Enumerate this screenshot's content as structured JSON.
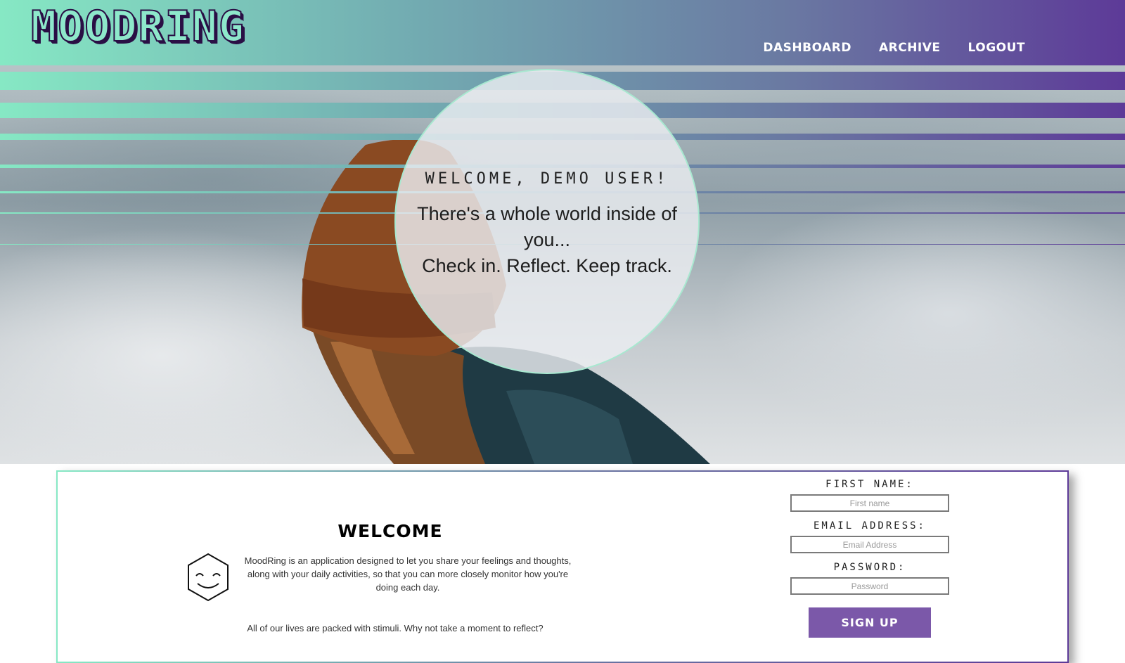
{
  "header": {
    "logo": "MOODRING",
    "nav": [
      {
        "label": "DASHBOARD"
      },
      {
        "label": "ARCHIVE"
      },
      {
        "label": "LOGOUT"
      }
    ]
  },
  "hero": {
    "greeting": "WELCOME, DEMO USER!",
    "tagline_line1": "There's a whole world inside of you...",
    "tagline_line2": "Check in. Reflect. Keep track."
  },
  "card": {
    "title": "WELCOME",
    "intro": "MoodRing is an application designed to let you share your feelings and thoughts, along with your daily activities, so that you can more closely monitor how you're doing each day.",
    "tagline": "All of our lives are packed with stimuli. Why not take a moment to reflect?",
    "icon": "smiley-hexagon-icon"
  },
  "form": {
    "first_name_label": "FIRST NAME:",
    "first_name_placeholder": "First name",
    "email_label": "EMAIL ADDRESS:",
    "email_placeholder": "Email Address",
    "password_label": "PASSWORD:",
    "password_placeholder": "Password",
    "submit_label": "SIGN UP"
  },
  "colors": {
    "gradient_start": "#86e8c4",
    "gradient_end": "#5d3a98",
    "button": "#7b58a9"
  }
}
